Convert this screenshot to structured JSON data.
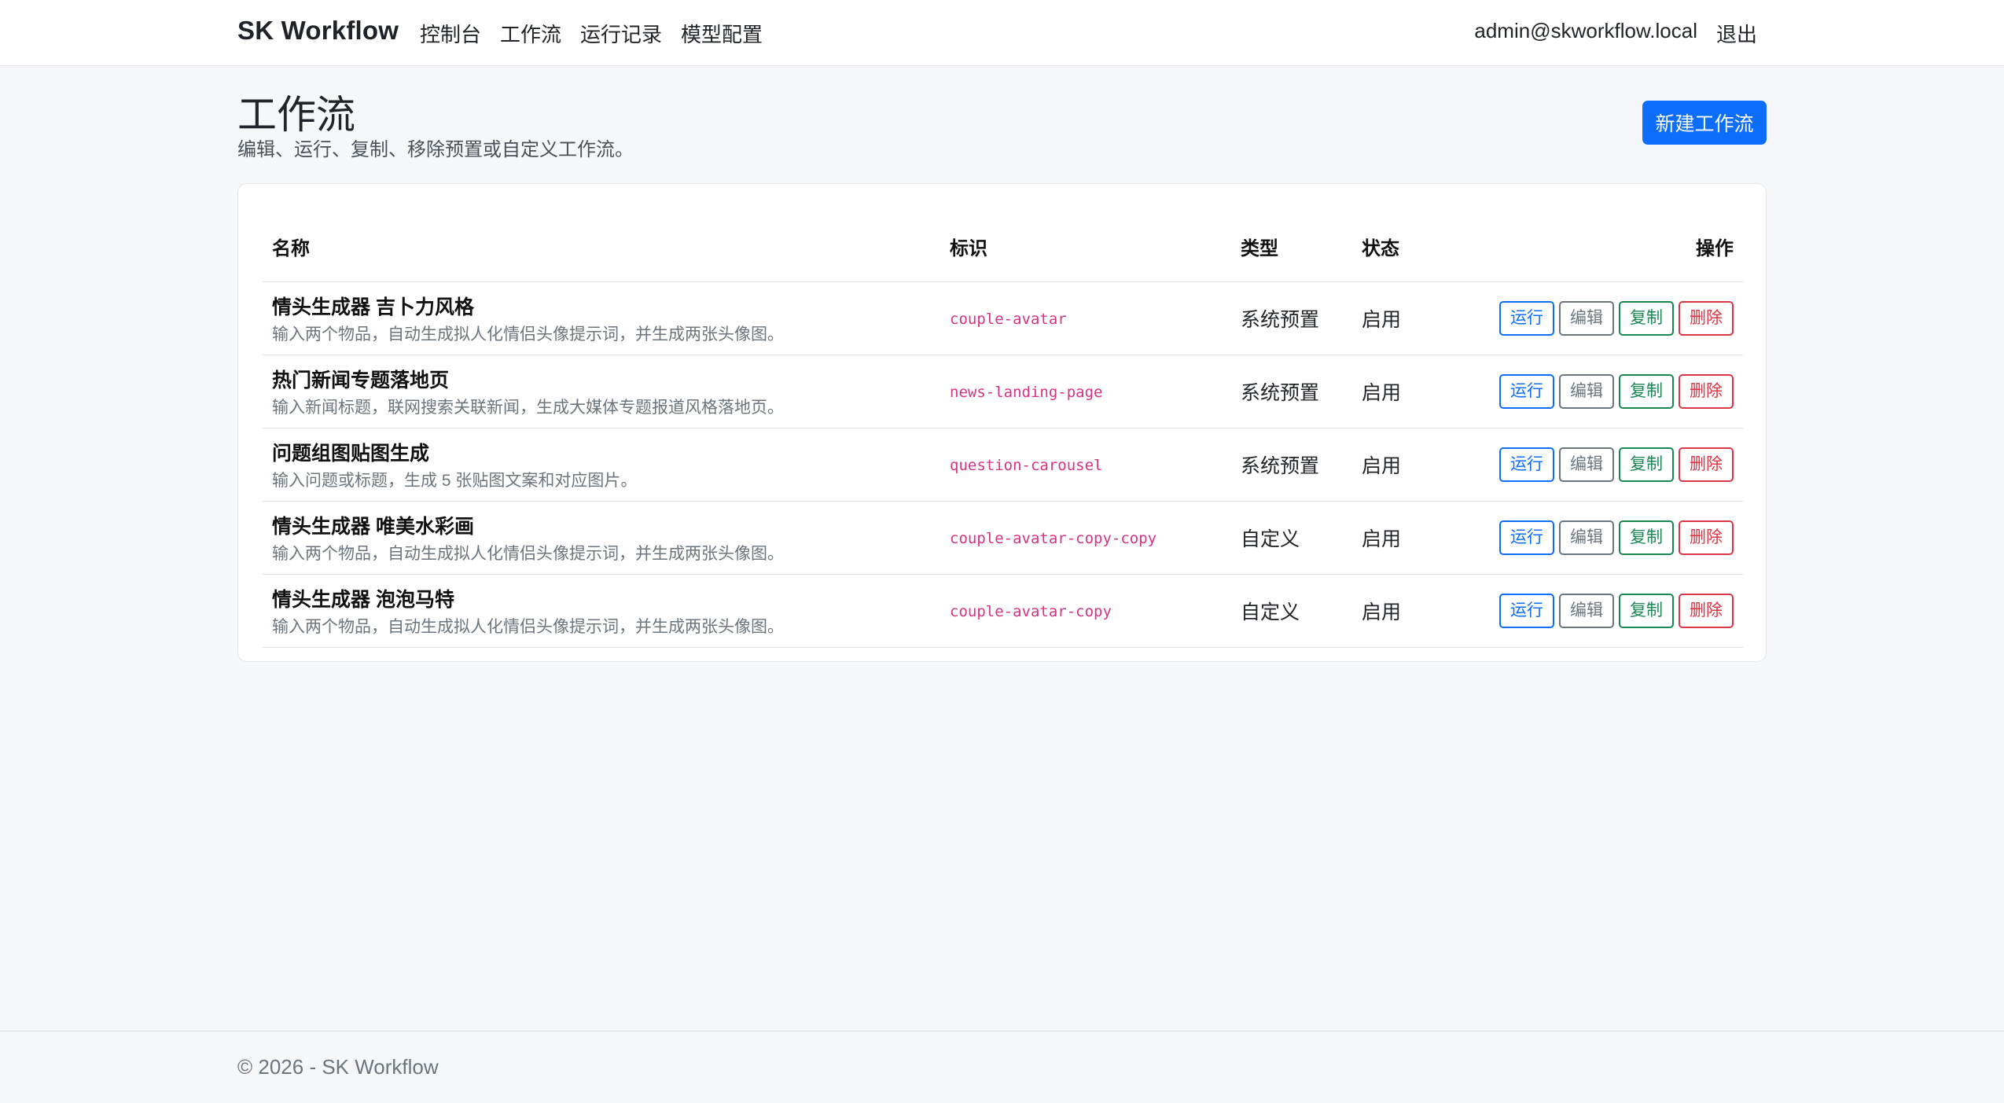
{
  "navbar": {
    "brand": "SK Workflow",
    "links": [
      "控制台",
      "工作流",
      "运行记录",
      "模型配置"
    ],
    "user_email": "admin@skworkflow.local",
    "logout": "退出"
  },
  "page": {
    "title": "工作流",
    "subtitle": "编辑、运行、复制、移除预置或自定义工作流。",
    "new_button": "新建工作流"
  },
  "table": {
    "headers": {
      "name": "名称",
      "key": "标识",
      "type": "类型",
      "status": "状态",
      "ops": "操作"
    },
    "actions": {
      "run": "运行",
      "edit": "编辑",
      "copy": "复制",
      "delete": "删除"
    },
    "rows": [
      {
        "name": "情头生成器 吉卜力风格",
        "desc": "输入两个物品，自动生成拟人化情侣头像提示词，并生成两张头像图。",
        "key": "couple-avatar",
        "type": "系统预置",
        "status": "启用"
      },
      {
        "name": "热门新闻专题落地页",
        "desc": "输入新闻标题，联网搜索关联新闻，生成大媒体专题报道风格落地页。",
        "key": "news-landing-page",
        "type": "系统预置",
        "status": "启用"
      },
      {
        "name": "问题组图贴图生成",
        "desc": "输入问题或标题，生成 5 张贴图文案和对应图片。",
        "key": "question-carousel",
        "type": "系统预置",
        "status": "启用"
      },
      {
        "name": "情头生成器 唯美水彩画",
        "desc": "输入两个物品，自动生成拟人化情侣头像提示词，并生成两张头像图。",
        "key": "couple-avatar-copy-copy",
        "type": "自定义",
        "status": "启用"
      },
      {
        "name": "情头生成器 泡泡马特",
        "desc": "输入两个物品，自动生成拟人化情侣头像提示词，并生成两张头像图。",
        "key": "couple-avatar-copy",
        "type": "自定义",
        "status": "启用"
      }
    ]
  },
  "footer": {
    "text": "© 2026 - SK Workflow"
  },
  "colors": {
    "primary": "#0d6efd",
    "secondary": "#6c757d",
    "success": "#198754",
    "danger": "#dc3545",
    "code": "#d63384"
  }
}
